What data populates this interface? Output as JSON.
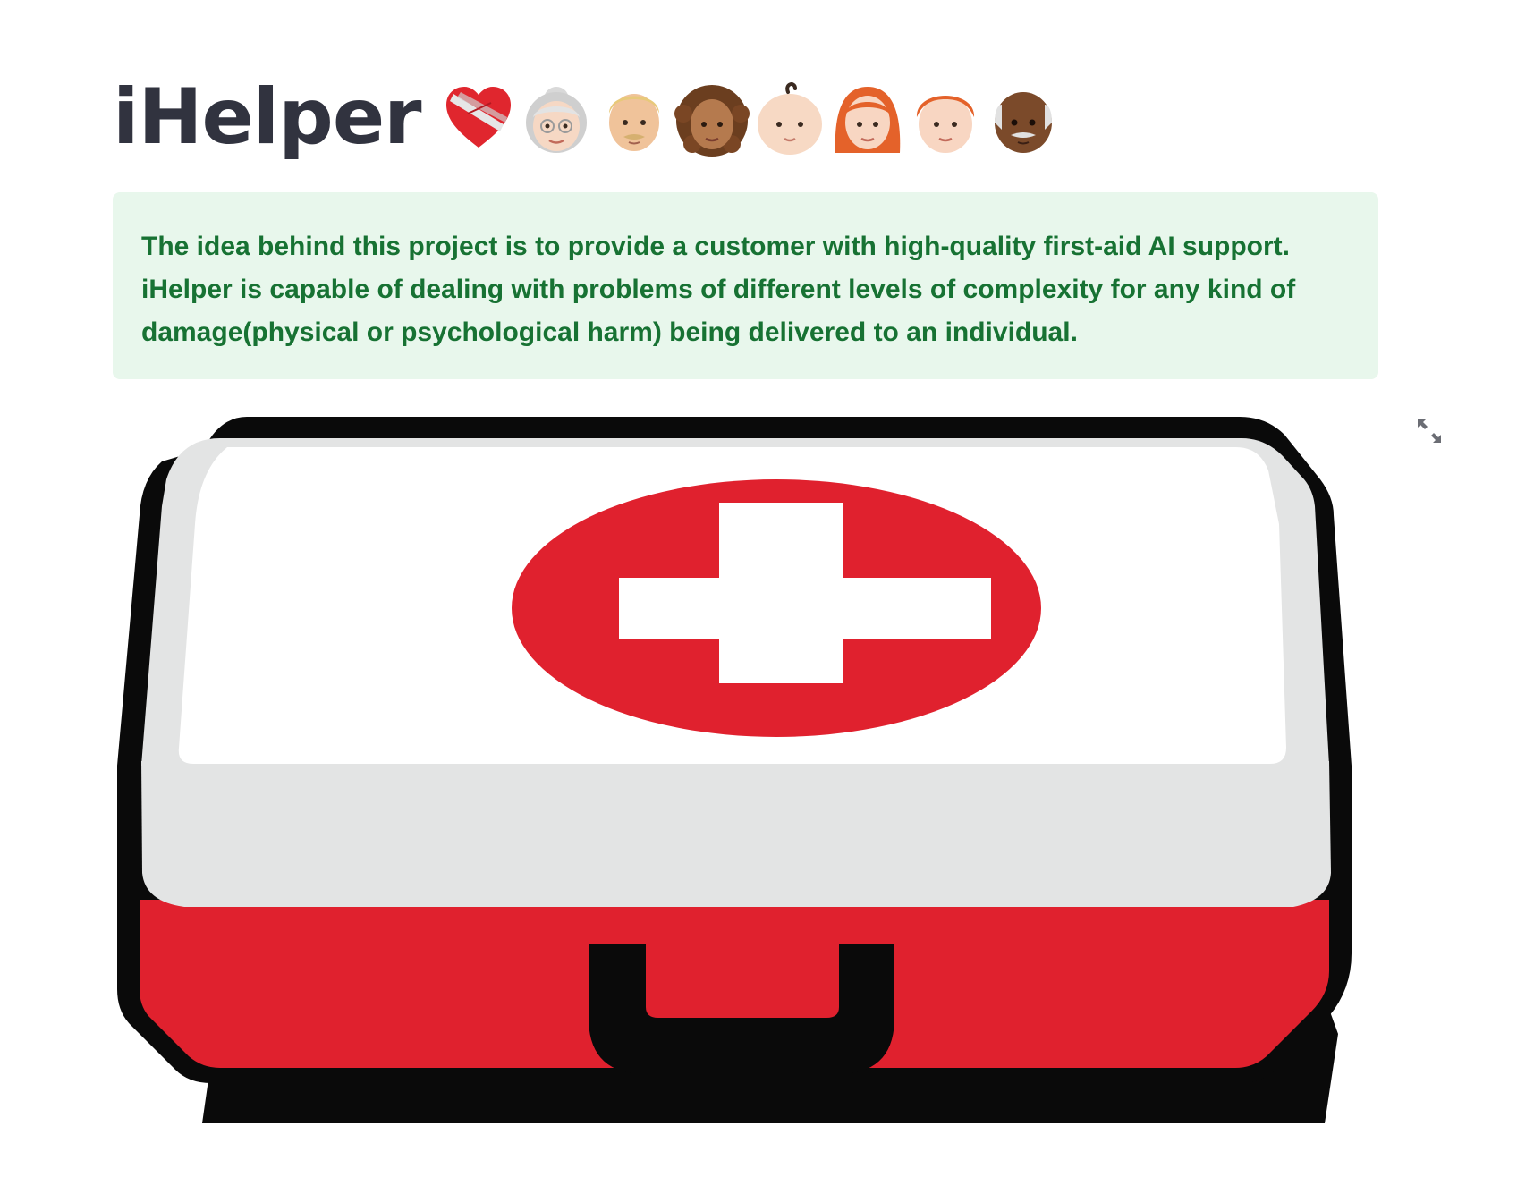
{
  "header": {
    "title": "iHelper",
    "emojis": [
      "mending-heart-icon",
      "old-woman-icon",
      "blond-man-icon",
      "curly-haired-woman-icon",
      "baby-icon",
      "red-haired-woman-icon",
      "red-haired-person-icon",
      "old-man-icon"
    ]
  },
  "info": {
    "text": "The idea behind this project is to provide a customer with high-quality first-aid AI support. iHelper is capable of dealing with problems of different levels of complexity for any kind of damage(physical or psychological harm) being delivered to an individual."
  },
  "image": {
    "subject": "first-aid-kit-illustration",
    "colors": {
      "red": "#e0212e",
      "white": "#ffffff",
      "gray": "#e3e4e4",
      "outline": "#0a0a0a"
    }
  },
  "toolbar": {
    "expand_icon": "expand-icon"
  },
  "theme": {
    "title_color": "#31333f",
    "info_bg": "#e8f7ec",
    "info_text": "#177233"
  }
}
